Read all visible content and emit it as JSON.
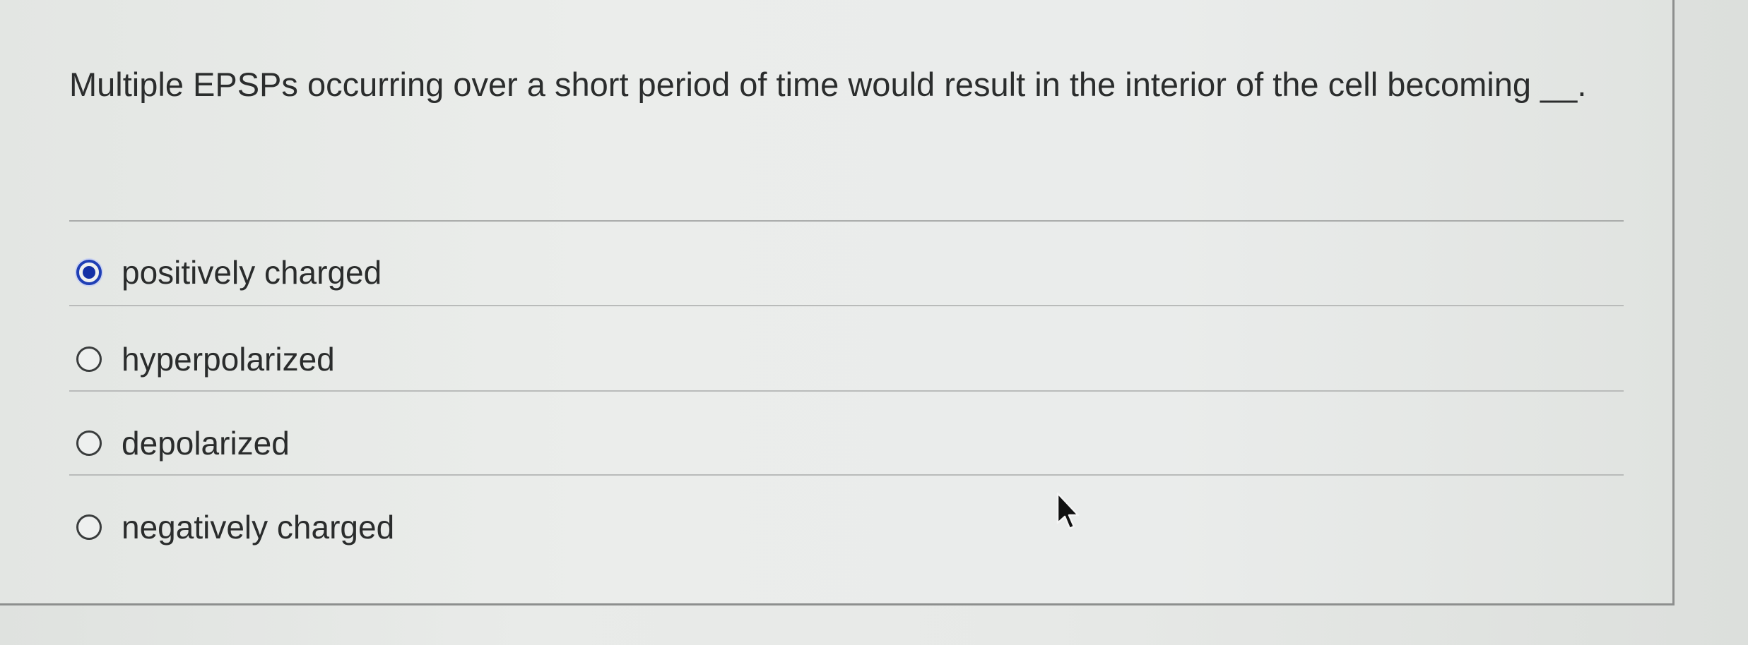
{
  "question": {
    "text": "Multiple EPSPs occurring over a short period of time would result in the interior of the cell becoming __."
  },
  "options": [
    {
      "label": "positively charged",
      "selected": true
    },
    {
      "label": "hyperpolarized",
      "selected": false
    },
    {
      "label": "depolarized",
      "selected": false
    },
    {
      "label": "negatively charged",
      "selected": false
    }
  ],
  "colors": {
    "selected_radio": "#1f3fb5",
    "text": "#2b2d2d",
    "divider": "#b9bbba"
  },
  "icons": {
    "cursor": "mouse-pointer-icon"
  }
}
